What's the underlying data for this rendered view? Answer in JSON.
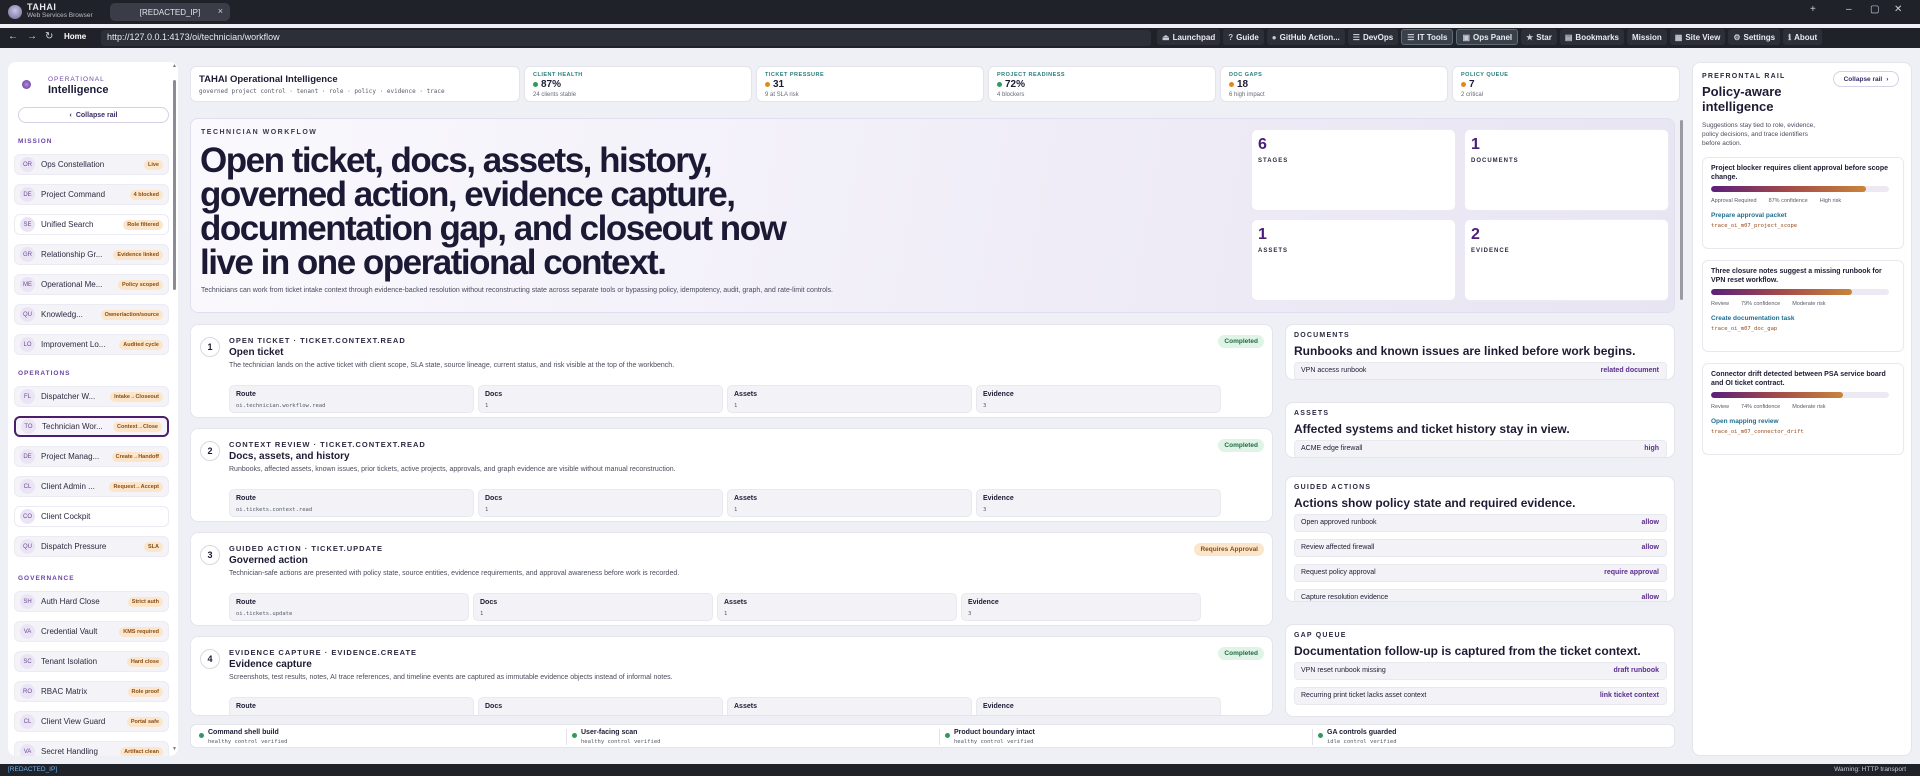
{
  "browser": {
    "brand_name": "TAHAI",
    "brand_sub": "Web Services Browser",
    "tab_title": "[REDACTED_IP]",
    "tab_close": "×",
    "new_tab": "+",
    "minimize": "–",
    "maximize": "▢",
    "close": "✕",
    "back": "←",
    "forward": "→",
    "reload": "↻",
    "home": "Home",
    "url": "http://127.0.0.1:4173/oi/technician/workflow",
    "toolbar": [
      {
        "icon": "⏏",
        "label": "Launchpad"
      },
      {
        "icon": "?",
        "label": "Guide"
      },
      {
        "icon": "●",
        "label": "GitHub Action..."
      },
      {
        "icon": "☰",
        "label": "DevOps"
      },
      {
        "icon": "☰",
        "label": "IT Tools"
      },
      {
        "icon": "▣",
        "label": "Ops Panel"
      },
      {
        "icon": "★",
        "label": "Star"
      },
      {
        "icon": "▤",
        "label": "Bookmarks"
      },
      {
        "icon": "",
        "label": "Mission"
      },
      {
        "icon": "▦",
        "label": "Site View"
      },
      {
        "icon": "⚙",
        "label": "Settings"
      },
      {
        "icon": "ℹ",
        "label": "About"
      }
    ]
  },
  "left_rail": {
    "sub": "OPERATIONAL",
    "title": "Intelligence",
    "collapse_icon": "‹",
    "collapse_label": "Collapse rail",
    "sections": {
      "mission": "MISSION",
      "operations": "OPERATIONS",
      "governance": "GOVERNANCE"
    },
    "mission_items": [
      {
        "abbr": "OR",
        "label": "Ops Constellation",
        "badge": "Live"
      },
      {
        "abbr": "DE",
        "label": "Project Command",
        "badge": "4 blocked"
      },
      {
        "abbr": "SE",
        "label": "Unified Search",
        "badge": "Role filtered"
      },
      {
        "abbr": "GR",
        "label": "Relationship Gr...",
        "badge": "Evidence linked"
      },
      {
        "abbr": "ME",
        "label": "Operational Me...",
        "badge": "Policy scoped"
      },
      {
        "abbr": "QU",
        "label": "Knowledg...",
        "badge": "Owner/action/source"
      },
      {
        "abbr": "LO",
        "label": "Improvement Lo...",
        "badge": "Audited cycle"
      }
    ],
    "operations_items": [
      {
        "abbr": "FL",
        "label": "Dispatcher W...",
        "badge": "Intake→Closeout"
      },
      {
        "abbr": "TO",
        "label": "Technician Wor...",
        "badge": "Context→Close"
      },
      {
        "abbr": "DE",
        "label": "Project Manag...",
        "badge": "Create→Handoff"
      },
      {
        "abbr": "CL",
        "label": "Client Admin ...",
        "badge": "Request→Accept"
      },
      {
        "abbr": "CO",
        "label": "Client Cockpit",
        "badge": ""
      },
      {
        "abbr": "QU",
        "label": "Dispatch Pressure",
        "badge": "SLA"
      }
    ],
    "governance_items": [
      {
        "abbr": "SH",
        "label": "Auth Hard Close",
        "badge": "Strict auth"
      },
      {
        "abbr": "VA",
        "label": "Credential Vault",
        "badge": "KMS required"
      },
      {
        "abbr": "SC",
        "label": "Tenant Isolation",
        "badge": "Hard close"
      },
      {
        "abbr": "RO",
        "label": "RBAC Matrix",
        "badge": "Role proof"
      },
      {
        "abbr": "CL",
        "label": "Client View Guard",
        "badge": "Portal safe"
      },
      {
        "abbr": "VA",
        "label": "Secret Handling",
        "badge": "Artifact clean"
      }
    ]
  },
  "kpis": {
    "title": "TAHAI Operational Intelligence",
    "subtitle": "governed project control · tenant · role · policy · evidence · trace",
    "items": [
      {
        "label": "CLIENT HEALTH",
        "value": "87%",
        "sub": "24 clients stable",
        "color": "#2e9a5e"
      },
      {
        "label": "TICKET PRESSURE",
        "value": "31",
        "sub": "9 at SLA risk",
        "color": "#e08a1c"
      },
      {
        "label": "PROJECT READINESS",
        "value": "72%",
        "sub": "4 blockers",
        "color": "#2e9a5e"
      },
      {
        "label": "DOC GAPS",
        "value": "18",
        "sub": "6 high impact",
        "color": "#e08a1c"
      },
      {
        "label": "POLICY QUEUE",
        "value": "7",
        "sub": "2 critical",
        "color": "#e08a1c"
      }
    ]
  },
  "hero": {
    "eyebrow": "TECHNICIAN WORKFLOW",
    "headline": "Open ticket, docs, assets, history, governed action, evidence capture, documentation gap, and closeout now live in one operational context.",
    "description": "Technicians can work from ticket intake context through evidence-backed resolution without reconstructing state across separate tools or bypassing policy, idempotency, audit, graph, and rate-limit controls.",
    "stats": [
      {
        "num": "6",
        "label": "STAGES"
      },
      {
        "num": "1",
        "label": "DOCUMENTS"
      },
      {
        "num": "1",
        "label": "ASSETS"
      },
      {
        "num": "2",
        "label": "EVIDENCE"
      }
    ]
  },
  "workflow": [
    {
      "num": "1",
      "step": "OPEN TICKET · TICKET.CONTEXT.READ",
      "title": "Open ticket",
      "desc": "The technician lands on the active ticket with client scope, SLA state, source lineage, current status, and risk visible at the top of the workbench.",
      "status": "Completed",
      "route": "oi.technician.workflow.read",
      "docs": "1",
      "assets": "1",
      "evidence": "3"
    },
    {
      "num": "2",
      "step": "CONTEXT REVIEW · TICKET.CONTEXT.READ",
      "title": "Docs, assets, and history",
      "desc": "Runbooks, affected assets, known issues, prior tickets, active projects, approvals, and graph evidence are visible without manual reconstruction.",
      "status": "Completed",
      "route": "oi.tickets.context.read",
      "docs": "1",
      "assets": "1",
      "evidence": "3"
    },
    {
      "num": "3",
      "step": "GUIDED ACTION · TICKET.UPDATE",
      "title": "Governed action",
      "desc": "Technician-safe actions are presented with policy state, source entities, evidence requirements, and approval awareness before work is recorded.",
      "status": "Requires Approval",
      "route": "oi.tickets.update",
      "docs": "1",
      "assets": "1",
      "evidence": "3"
    },
    {
      "num": "4",
      "step": "EVIDENCE CAPTURE · EVIDENCE.CREATE",
      "title": "Evidence capture",
      "desc": "Screenshots, test results, notes, AI trace references, and timeline events are captured as immutable evidence objects instead of informal notes.",
      "status": "Completed",
      "route": "",
      "docs": "",
      "assets": "",
      "evidence": ""
    }
  ],
  "field_labels": {
    "route": "Route",
    "docs": "Docs",
    "assets": "Assets",
    "evidence": "Evidence"
  },
  "context": {
    "documents": {
      "label": "DOCUMENTS",
      "heading": "Runbooks and known issues are linked before work begins.",
      "rows": [
        {
          "label": "VPN access runbook",
          "value": "related document"
        }
      ]
    },
    "assets": {
      "label": "ASSETS",
      "heading": "Affected systems and ticket history stay in view.",
      "rows": [
        {
          "label": "ACME edge firewall",
          "value": "high"
        }
      ]
    },
    "actions": {
      "label": "GUIDED ACTIONS",
      "heading": "Actions show policy state and required evidence.",
      "rows": [
        {
          "label": "Open approved runbook",
          "value": "allow"
        },
        {
          "label": "Review affected firewall",
          "value": "allow"
        },
        {
          "label": "Request policy approval",
          "value": "require approval"
        },
        {
          "label": "Capture resolution evidence",
          "value": "allow"
        }
      ]
    },
    "gaps": {
      "label": "GAP QUEUE",
      "heading": "Documentation follow-up is captured from the ticket context.",
      "rows": [
        {
          "label": "VPN reset runbook missing",
          "value": "draft runbook"
        },
        {
          "label": "Recurring print ticket lacks asset context",
          "value": "link ticket context"
        }
      ]
    }
  },
  "footer": [
    {
      "title": "Command shell build",
      "sub": "healthy control verified"
    },
    {
      "title": "User-facing scan",
      "sub": "healthy control verified"
    },
    {
      "title": "Product boundary intact",
      "sub": "healthy control verified"
    },
    {
      "title": "GA controls guarded",
      "sub": "idle control verified"
    }
  ],
  "prefrontal": {
    "label": "PREFRONTAL RAIL",
    "title": "Policy-aware intelligence",
    "collapse_label": "Collapse rail",
    "collapse_icon": "›",
    "desc": "Suggestions stay tied to role, evidence, policy decisions, and trace identifiers before action.",
    "signals": [
      {
        "title": "Project blocker requires client approval before scope change.",
        "fill_pct": 87,
        "meta": [
          "Approval Required",
          "87% confidence",
          "High risk"
        ],
        "link": "Prepare approval packet",
        "trace": "trace_oi_m07_project_scope"
      },
      {
        "title": "Three closure notes suggest a missing runbook for VPN reset workflow.",
        "fill_pct": 79,
        "meta": [
          "Review",
          "79% confidence",
          "Moderate risk"
        ],
        "link": "Create documentation task",
        "trace": "trace_oi_m07_doc_gap"
      },
      {
        "title": "Connector drift detected between PSA service board and OI ticket contract.",
        "fill_pct": 74,
        "meta": [
          "Review",
          "74% confidence",
          "Moderate risk"
        ],
        "link": "Open mapping review",
        "trace": "trace_oi_m07_connector_drift"
      }
    ]
  },
  "status_bar": {
    "left": "[REDACTED_IP]",
    "right": "Warning: HTTP transport"
  }
}
